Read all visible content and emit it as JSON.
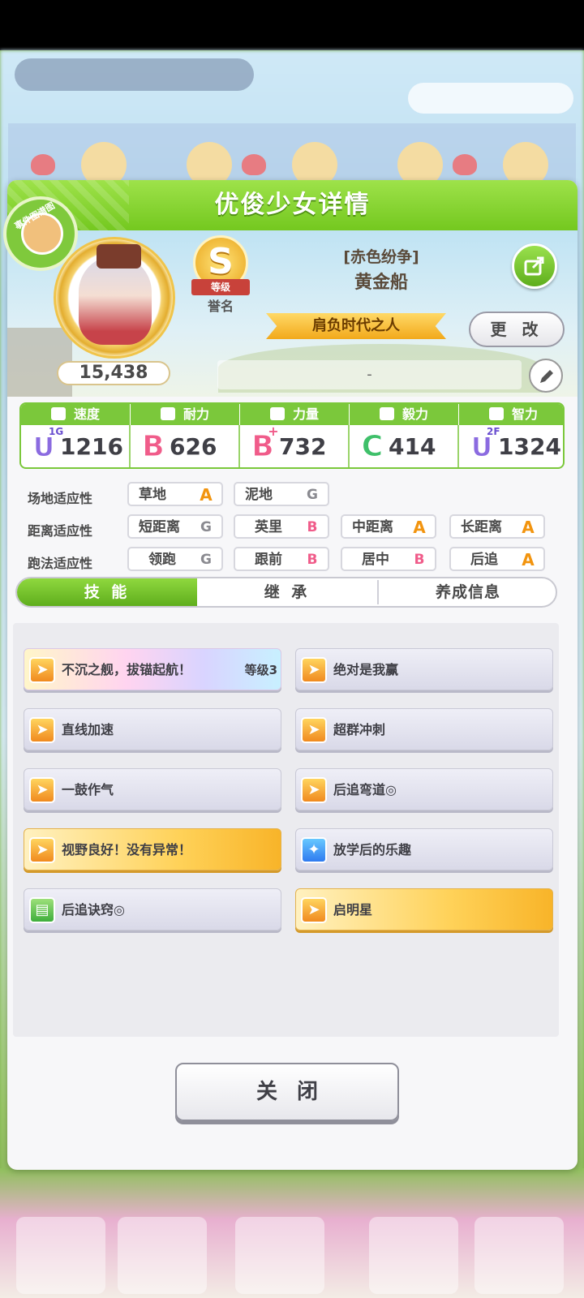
{
  "dialog": {
    "title": "优俊少女详情",
    "event_badge": "事件图谱图"
  },
  "profile": {
    "rating": "15,438",
    "rank_letter": "S",
    "rank_ribbon": "等级",
    "rank_name": "誉名",
    "outfit": "[赤色纷争]",
    "name": "黄金船",
    "title": "肩负时代之人",
    "change_label": "更 改",
    "note": "-"
  },
  "stats": [
    {
      "label": "速度",
      "grade": "U",
      "grade_sup": "1G",
      "value": "1216",
      "icon": "shoe-icon"
    },
    {
      "label": "耐力",
      "grade": "B",
      "grade_sup": "",
      "value": "626",
      "icon": "heart-icon"
    },
    {
      "label": "力量",
      "grade": "B",
      "grade_sup": "+",
      "value": "732",
      "icon": "arm-icon"
    },
    {
      "label": "毅力",
      "grade": "C",
      "grade_sup": "",
      "value": "414",
      "icon": "flame-icon"
    },
    {
      "label": "智力",
      "grade": "U",
      "grade_sup": "2F",
      "value": "1324",
      "icon": "cap-icon"
    }
  ],
  "aptitude": {
    "track": {
      "label": "场地适应性",
      "items": [
        {
          "name": "草地",
          "grade": "A"
        },
        {
          "name": "泥地",
          "grade": "G"
        }
      ]
    },
    "distance": {
      "label": "距离适应性",
      "items": [
        {
          "name": "短距离",
          "grade": "G"
        },
        {
          "name": "英里",
          "grade": "B"
        },
        {
          "name": "中距离",
          "grade": "A"
        },
        {
          "name": "长距离",
          "grade": "A"
        }
      ]
    },
    "style": {
      "label": "跑法适应性",
      "items": [
        {
          "name": "领跑",
          "grade": "G"
        },
        {
          "name": "跟前",
          "grade": "B"
        },
        {
          "name": "居中",
          "grade": "B"
        },
        {
          "name": "后追",
          "grade": "A"
        }
      ]
    }
  },
  "tabs": [
    {
      "label": "技 能",
      "active": true
    },
    {
      "label": "继 承",
      "active": false
    },
    {
      "label": "养成信息",
      "active": false
    }
  ],
  "skills": [
    {
      "name": "不沉之舰，拔锚起航！",
      "level": "等级3",
      "style": "rainbow",
      "icon": "runner-icon"
    },
    {
      "name": "绝对是我赢",
      "level": "",
      "style": "normal",
      "icon": "runner-icon"
    },
    {
      "name": "直线加速",
      "level": "",
      "style": "normal",
      "icon": "runner-icon"
    },
    {
      "name": "超群冲刺",
      "level": "",
      "style": "normal",
      "icon": "runner-icon"
    },
    {
      "name": "一鼓作气",
      "level": "",
      "style": "normal",
      "icon": "runner-icon"
    },
    {
      "name": "后追弯道◎",
      "level": "",
      "style": "normal",
      "icon": "runner-icon"
    },
    {
      "name": "视野良好！没有异常！",
      "level": "",
      "style": "gold",
      "icon": "runner-icon"
    },
    {
      "name": "放学后的乐趣",
      "level": "",
      "style": "normal",
      "icon": "sparkle-icon"
    },
    {
      "name": "后追诀窍◎",
      "level": "",
      "style": "normal",
      "icon": "book-icon"
    },
    {
      "name": "启明星",
      "level": "",
      "style": "gold",
      "icon": "runner-icon"
    }
  ],
  "close_label": "关闭",
  "colors": {
    "header_green": "#74c81f",
    "grade_A": "#f2940f",
    "grade_B": "#f05c8a",
    "grade_C": "#3fc06a",
    "grade_U": "#8b6be0"
  }
}
